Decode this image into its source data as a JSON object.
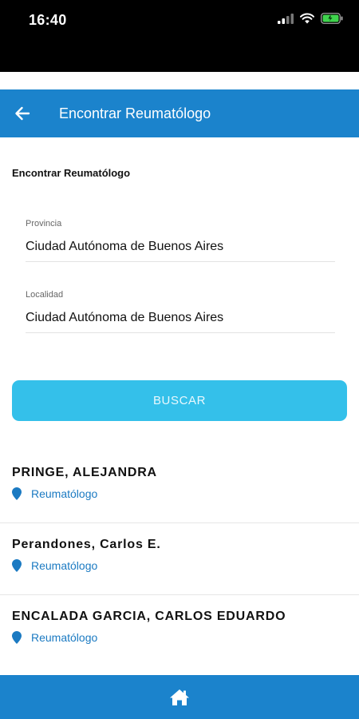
{
  "status_bar": {
    "time": "16:40",
    "icons": [
      "signal-icon",
      "wifi-icon",
      "battery-icon"
    ]
  },
  "header": {
    "title": "Encontrar Reumatólogo",
    "back_icon": "back-arrow-icon"
  },
  "form": {
    "section_title": "Encontrar Reumatólogo",
    "provincia": {
      "label": "Provincia",
      "value": "Ciudad Autónoma de Buenos Aires"
    },
    "localidad": {
      "label": "Localidad",
      "value": "Ciudad Autónoma de Buenos Aires"
    },
    "search_button": "BUSCAR"
  },
  "results": [
    {
      "name": "PRINGE, ALEJANDRA",
      "specialty": "Reumatólogo"
    },
    {
      "name": "Perandones, Carlos E.",
      "specialty": "Reumatólogo"
    },
    {
      "name": "ENCALADA GARCIA, CARLOS EDUARDO",
      "specialty": "Reumatólogo"
    }
  ],
  "bottom_nav": {
    "home_icon": "home-icon"
  },
  "colors": {
    "primary": "#1b83cc",
    "button": "#34c0ea",
    "link": "#1b7ac2"
  }
}
